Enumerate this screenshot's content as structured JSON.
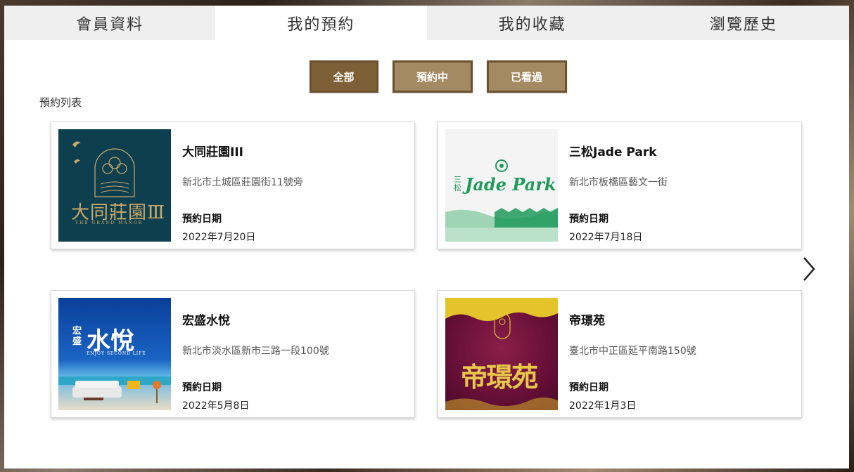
{
  "tabs": [
    {
      "label": "會員資料",
      "active": false
    },
    {
      "label": "我的預約",
      "active": true
    },
    {
      "label": "我的收藏",
      "active": false
    },
    {
      "label": "瀏覽歷史",
      "active": false
    }
  ],
  "filters": {
    "all": "全部",
    "booking": "預約中",
    "viewed": "已看過"
  },
  "list_label": "預約列表",
  "date_label": "預約日期",
  "cards": [
    {
      "title": "大同莊園III",
      "address": "新北市土城區莊園街11號旁",
      "date": "2022年7月20日",
      "logo_text": "大同莊園Ⅲ",
      "logo_sub": "THE GRAND MANOR"
    },
    {
      "title": "三松Jade Park",
      "address": "新北市板橋區藝文一街",
      "date": "2022年7月18日",
      "logo_text": "Jade Park",
      "logo_prefix": "三松"
    },
    {
      "title": "宏盛水悅",
      "address": "新北市淡水區新市三路一段100號",
      "date": "2022年5月8日",
      "logo_text": "水悅",
      "logo_prefix": "宏盛",
      "logo_sub": "ENJOY SECOND LIFE"
    },
    {
      "title": "帝璟苑",
      "address": "臺北市中正區延平南路150號",
      "date": "2022年1月3日",
      "logo_text": "帝璟苑"
    }
  ],
  "colors": {
    "filter_active": "#7e6036",
    "filter_inactive": "#a48a62",
    "tab_inactive": "#efefef"
  }
}
